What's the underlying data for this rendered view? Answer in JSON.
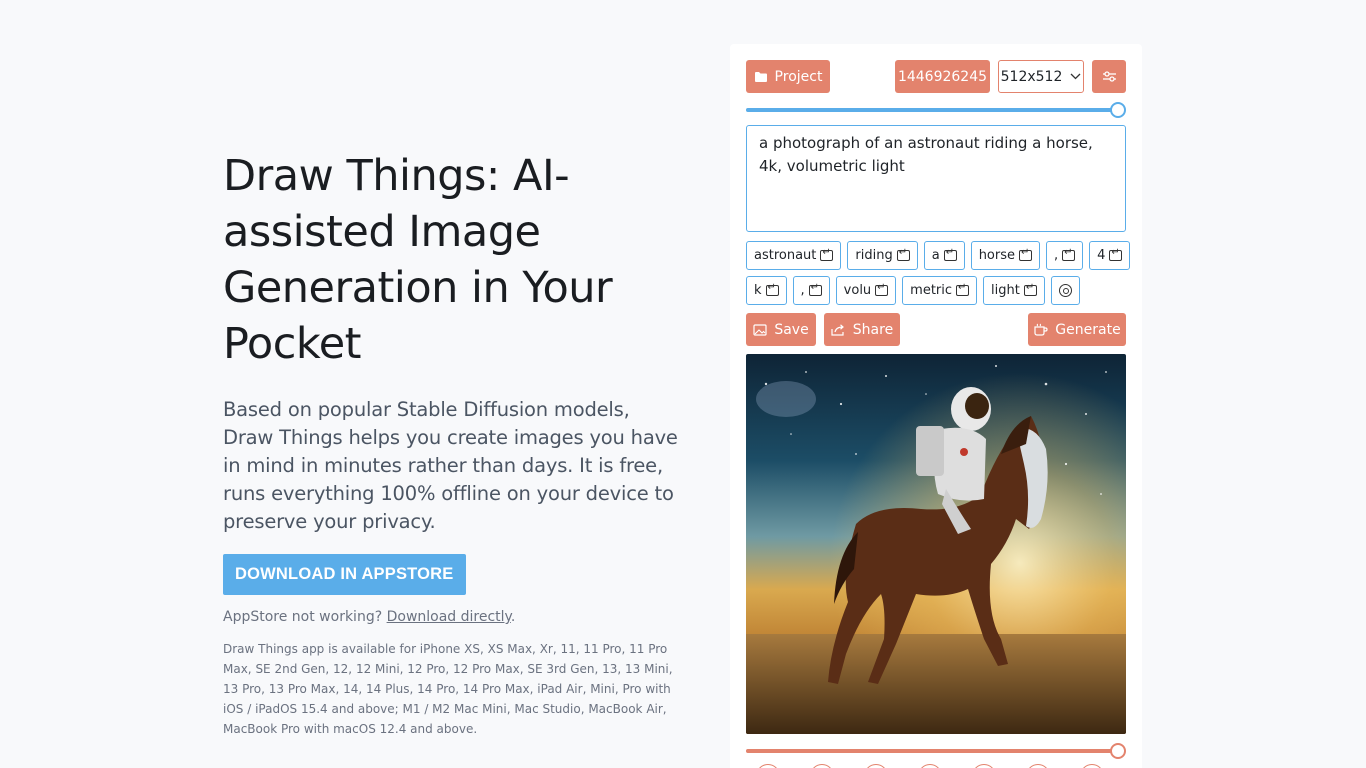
{
  "hero": {
    "title": "Draw Things: AI-assisted Image Generation in Your Pocket",
    "description": "Based on popular Stable Diffusion models, Draw Things helps you create images you have in mind in minutes rather than days. It is free, runs everything 100% offline on your device to preserve your privacy.",
    "download_label": "DOWNLOAD IN APPSTORE",
    "appstore_note_prefix": "AppStore not working? ",
    "appstore_note_link": "Download directly",
    "appstore_note_suffix": ".",
    "compatibility": "Draw Things app is available for iPhone XS, XS Max, Xr, 11, 11 Pro, 11 Pro Max, SE 2nd Gen, 12, 12 Mini, 12 Pro, 12 Pro Max, SE 3rd Gen, 13, 13 Mini, 13 Pro, 13 Pro Max, 14, 14 Plus, 14 Pro, 14 Pro Max, iPad Air, Mini, Pro with iOS / iPadOS 15.4 and above; M1 / M2 Mac Mini, Mac Studio, MacBook Air, MacBook Pro with macOS 12.4 and above."
  },
  "demo": {
    "project_label": "Project",
    "seed_value": "1446926245",
    "size_value": "512x512",
    "steps_slider_fraction": 1.0,
    "prompt_text": "a photograph of an astronaut riding a horse, 4k, volumetric light",
    "tokens": [
      "astronaut",
      "riding",
      "a",
      "horse",
      ",",
      "4",
      "k",
      ",",
      "volu",
      "metric",
      "light"
    ],
    "save_label": "Save",
    "share_label": "Share",
    "generate_label": "Generate",
    "guidance_slider_fraction": 1.0
  },
  "colors": {
    "accent_blue": "#5aade9",
    "accent_orange": "#e3836d",
    "background": "#f8f9fb"
  },
  "icons": [
    "folder-icon",
    "sliders-icon",
    "chevron-down-icon",
    "enter-icon",
    "circle-dot-icon",
    "image-icon",
    "share-icon",
    "cup-icon"
  ]
}
